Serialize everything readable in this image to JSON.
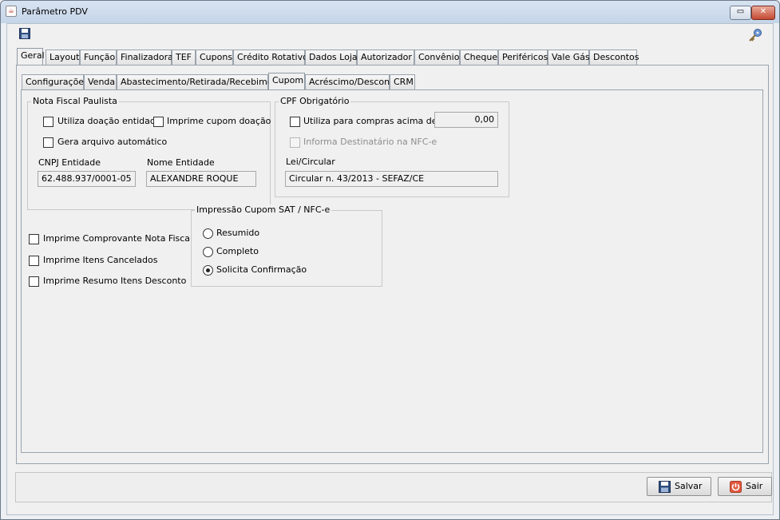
{
  "window": {
    "title": "Parâmetro PDV"
  },
  "main_tabs": [
    {
      "label": "Geral",
      "selected": true
    },
    {
      "label": "Layout"
    },
    {
      "label": "Função"
    },
    {
      "label": "Finalizadora"
    },
    {
      "label": "TEF"
    },
    {
      "label": "Cupons"
    },
    {
      "label": "Crédito Rotativo"
    },
    {
      "label": "Dados Loja"
    },
    {
      "label": "Autorizador"
    },
    {
      "label": "Convênio"
    },
    {
      "label": "Cheque"
    },
    {
      "label": "Periféricos"
    },
    {
      "label": "Vale Gás"
    },
    {
      "label": "Descontos"
    }
  ],
  "sub_tabs": [
    {
      "label": "Configurações"
    },
    {
      "label": "Venda"
    },
    {
      "label": "Abastecimento/Retirada/Recebimento"
    },
    {
      "label": "Cupom",
      "selected": true
    },
    {
      "label": "Acréscimo/Desconto"
    },
    {
      "label": "CRM"
    }
  ],
  "nota_fiscal_paulista": {
    "legend": "Nota Fiscal Paulista",
    "utiliza_doacao_label": "Utiliza doação entidade",
    "imprime_cupom_doacao_label": "Imprime cupom doação",
    "gera_arquivo_label": "Gera arquivo automático",
    "cnpj_label": "CNPJ Entidade",
    "cnpj_value": "62.488.937/0001-05",
    "nome_label": "Nome Entidade",
    "nome_value": "ALEXANDRE ROQUE"
  },
  "cpf_obrigatorio": {
    "legend": "CPF Obrigatório",
    "utiliza_compras_label": "Utiliza para compras acima de R$",
    "valor": "0,00",
    "informa_destinatario_label": "Informa Destinatário na NFC-e",
    "lei_label": "Lei/Circular",
    "lei_value": "Circular n. 43/2013 - SEFAZ/CE"
  },
  "options": {
    "imprime_comprovante_label": "Imprime Comprovante Nota Fiscal",
    "imprime_itens_cancelados_label": "Imprime Itens Cancelados",
    "imprime_resumo_label": "Imprime Resumo Itens Desconto"
  },
  "impressao_cupom": {
    "legend": "Impressão Cupom SAT / NFC-e",
    "resumido_label": "Resumido",
    "completo_label": "Completo",
    "solicita_label": "Solicita Confirmação",
    "selected": "Solicita Confirmação"
  },
  "buttons": {
    "salvar_label": "Salvar",
    "sair_label": "Sair"
  },
  "icons": {
    "save": "floppy-disk-icon",
    "key": "key-icon",
    "exit": "power-icon"
  },
  "colors": {
    "titlebar": "#c5d5e8",
    "close_button": "#c44a32",
    "exit_icon": "#e2583e",
    "key_icon": "#5a86c4"
  }
}
